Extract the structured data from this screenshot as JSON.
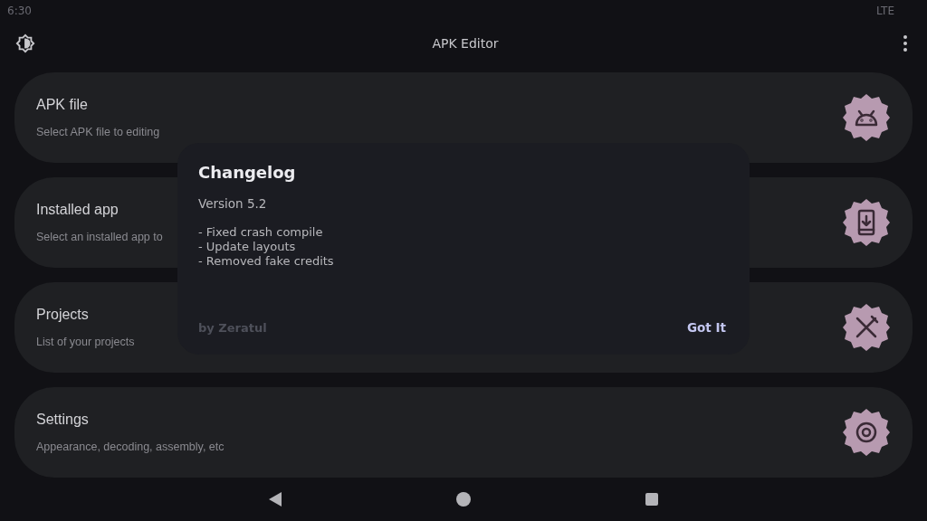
{
  "status_bar": {
    "time": "6:30",
    "network": "LTE"
  },
  "app_bar": {
    "title": "APK Editor"
  },
  "cards": [
    {
      "title": "APK file",
      "subtitle": "Select APK file to editing"
    },
    {
      "title": "Installed app",
      "subtitle": "Select an installed app to"
    },
    {
      "title": "Projects",
      "subtitle": "List of your projects"
    },
    {
      "title": "Settings",
      "subtitle": "Appearance, decoding, assembly, etc"
    }
  ],
  "dialog": {
    "title": "Changelog",
    "version": "Version 5.2",
    "changes": [
      "- Fixed crash compile",
      "- Update layouts",
      "- Removed fake credits"
    ],
    "author": "by Zeratul",
    "button": "Got It"
  }
}
